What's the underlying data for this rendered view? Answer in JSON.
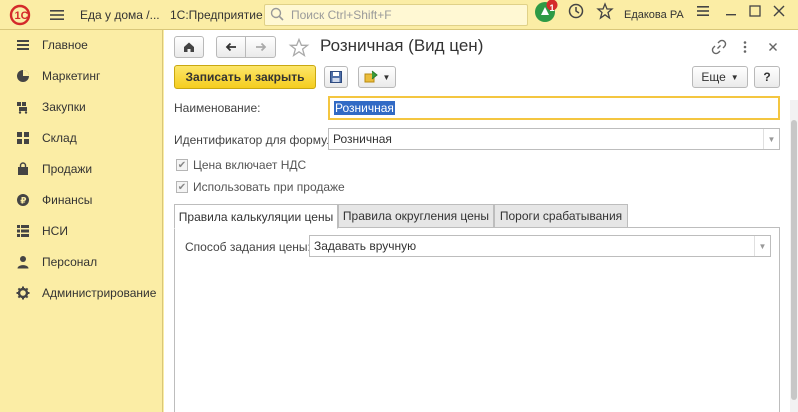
{
  "titlebar": {
    "app_title": "Еда у дома /...",
    "app_sub": "1С:Предприятие",
    "search_placeholder": "Поиск Ctrl+Shift+F",
    "notification_count": "1",
    "user_name": "Едакова РА",
    "logo_icon": "1c-logo-icon"
  },
  "sidebar": {
    "items": [
      {
        "label": "Главное",
        "icon": "menu-lines-icon"
      },
      {
        "label": "Маркетинг",
        "icon": "pie-chart-icon"
      },
      {
        "label": "Закупки",
        "icon": "cart-icon"
      },
      {
        "label": "Склад",
        "icon": "warehouse-grid-icon"
      },
      {
        "label": "Продажи",
        "icon": "bag-icon"
      },
      {
        "label": "Финансы",
        "icon": "coin-icon"
      },
      {
        "label": "НСИ",
        "icon": "catalog-icon"
      },
      {
        "label": "Персонал",
        "icon": "person-icon"
      },
      {
        "label": "Администрирование",
        "icon": "gear-icon"
      }
    ]
  },
  "form": {
    "title": "Розничная (Вид цен)",
    "save_close_label": "Записать и закрыть",
    "more_label": "Еще",
    "help_label": "?",
    "name_label": "Наименование:",
    "name_value": "Розничная",
    "formula_id_label": "Идентификатор для формул:",
    "formula_id_value": "Розничная",
    "vat_included_label": "Цена включает НДС",
    "use_for_sale_label": "Использовать при продаже",
    "tabs": [
      {
        "label": "Правила калькуляции цены",
        "active": true
      },
      {
        "label": "Правила округления цены",
        "active": false
      },
      {
        "label": "Пороги срабатывания",
        "active": false
      }
    ],
    "method_label": "Способ задания цены:",
    "method_value": "Задавать вручную"
  },
  "colors": {
    "accent_yellow": "#f5cd1e",
    "sidebar_bg": "#fbeda5",
    "notify_red": "#d42a2a",
    "notify_green": "#2e9a45",
    "selection_blue": "#316ac5"
  }
}
